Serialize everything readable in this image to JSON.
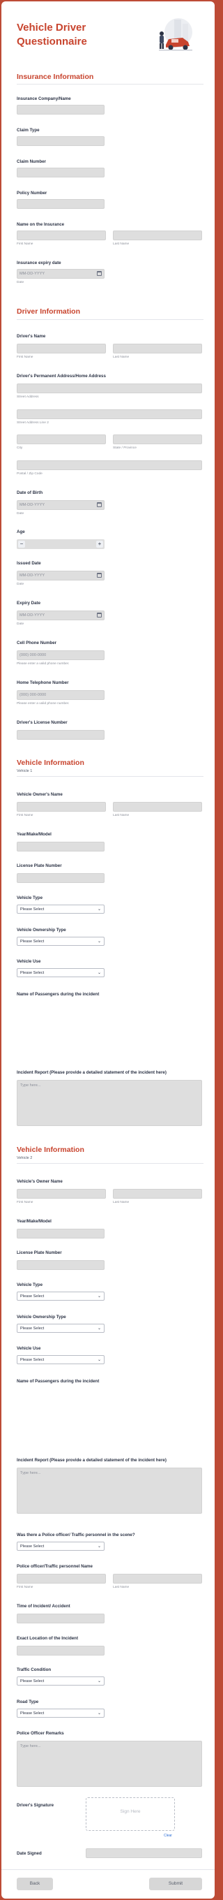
{
  "title": "Vehicle Driver Questionnaire",
  "colors": {
    "accent": "#c8442e",
    "frame": "#bd4b36",
    "field": "#dedede"
  },
  "insurance": {
    "heading": "Insurance Information",
    "company_label": "Insurance Company/Name",
    "claim_type_label": "Claim Type",
    "claim_number_label": "Claim Number",
    "policy_number_label": "Policy Number",
    "name_label": "Name on the Insurance",
    "first_name": "First Name",
    "last_name": "Last Name",
    "expiry_label": "Insurance expiry date",
    "date_placeholder": "MM-DD-YYYY",
    "date_hint": "Date"
  },
  "driver": {
    "heading": "Driver Information",
    "name_label": "Driver's Name",
    "first_name": "First Name",
    "last_name": "Last Name",
    "address_label": "Driver's Permanent Address/Home Address",
    "street1": "Street Address",
    "street2": "Street Address Line 2",
    "city": "City",
    "state": "State / Province",
    "postal": "Postal / Zip Code",
    "dob_label": "Date of Birth",
    "date_placeholder": "MM-DD-YYYY",
    "date_hint": "Date",
    "age_label": "Age",
    "age_minus": "−",
    "age_plus": "+",
    "issued_label": "Issued Date",
    "expiry_label": "Expiry Date",
    "cell_label": "Cell Phone Number",
    "phone_placeholder": "(000) 000-0000",
    "phone_hint": "Please enter a valid phone number.",
    "home_label": "Home Telephone Number",
    "license_label": "Driver's License Number"
  },
  "vehicle1": {
    "heading": "Vehicle Information",
    "sub": "Vehicle 1",
    "owner_label": "Vehicle Owner's Name",
    "first_name": "First Name",
    "last_name": "Last Name",
    "ymm_label": "Year/Make/Model",
    "plate_label": "License Plate Number",
    "type_label": "Vehicle Type",
    "ownership_label": "Vehicle Ownership Type",
    "use_label": "Vehicle Use",
    "select_placeholder": "Please Select",
    "passengers_label": "Name of Passengers during the incident",
    "report_label": "Incident Report (Please provide a detailed statement of the incident here)",
    "report_placeholder": "Type here..."
  },
  "vehicle2": {
    "heading": "Vehicle Information",
    "sub": "Vehicle 2",
    "owner_label": "Vehicle's Owner Name",
    "first_name": "First Name",
    "last_name": "Last Name",
    "ymm_label": "Year/Make/Model",
    "plate_label": "License Plate Number",
    "type_label": "Vehicle Type",
    "ownership_label": "Vehicle Ownership Type",
    "use_label": "Vehicle Use",
    "select_placeholder": "Please Select",
    "passengers_label": "Name of Passengers during the incident",
    "report_label": "Incident Report (Please provide a detailed statement of the incident here)",
    "report_placeholder": "Type here..."
  },
  "scene": {
    "police_q_label": "Was there a Police officer/ Traffic personnel in the scene?",
    "select_placeholder": "Please Select",
    "officer_name_label": "Police officer/Traffic personnel Name",
    "first_name": "First Name",
    "last_name": "Last Name",
    "time_label": "Time of Incident/ Accident",
    "location_label": "Exact Location of the Incident",
    "traffic_label": "Traffic Condition",
    "road_label": "Road Type",
    "remarks_label": "Police Officer Remarks",
    "remarks_placeholder": "Type here...",
    "signature_label": "Driver's Signature",
    "signature_placeholder": "Sign Here",
    "clear": "Clear",
    "date_signed_label": "Date Signed"
  },
  "footer": {
    "back": "Back",
    "submit": "Submit"
  }
}
